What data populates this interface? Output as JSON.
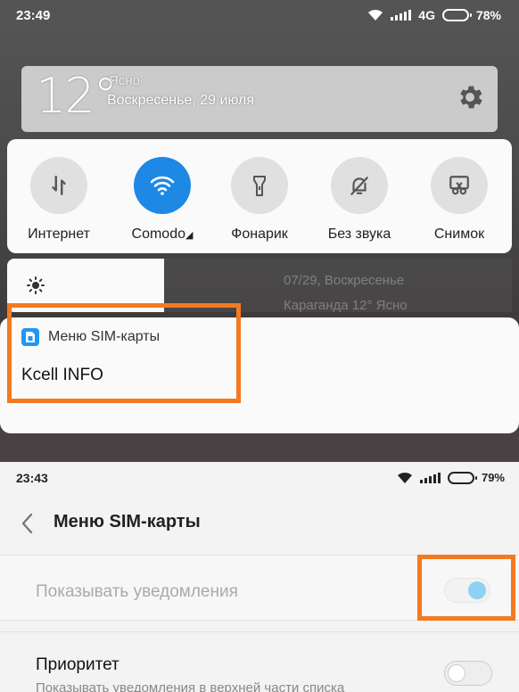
{
  "shade": {
    "status": {
      "time": "23:49",
      "network": "4G",
      "battery": "78%"
    },
    "weather": {
      "temperature": "12°",
      "condition": "Ясно",
      "date": "Воскресенье, 29 июля"
    },
    "quick_tiles": [
      {
        "label": "Интернет",
        "icon": "data-arrows-icon",
        "active": false
      },
      {
        "label": "Comodo",
        "icon": "wifi-icon",
        "active": true
      },
      {
        "label": "Фонарик",
        "icon": "flashlight-icon",
        "active": false
      },
      {
        "label": "Без звука",
        "icon": "bell-off-icon",
        "active": false
      },
      {
        "label": "Снимок",
        "icon": "scissors-icon",
        "active": false
      }
    ],
    "lockscreen_faded": {
      "date": "07/29, Воскресенье",
      "weather": "Караганда 12° Ясно"
    },
    "notification": {
      "app_name": "Меню SIM-карты",
      "title": "Kcell INFO"
    }
  },
  "settings": {
    "status": {
      "time": "23:43",
      "battery": "79%"
    },
    "header": {
      "title": "Меню SIM-карты"
    },
    "rows": [
      {
        "label": "Показывать уведомления",
        "enabled": true
      },
      {
        "label": "Приоритет",
        "sub": "Показывать уведомления в верхней части списка",
        "enabled": false
      }
    ]
  },
  "colors": {
    "accent": "#1e88e5",
    "highlight": "#f47a20"
  }
}
